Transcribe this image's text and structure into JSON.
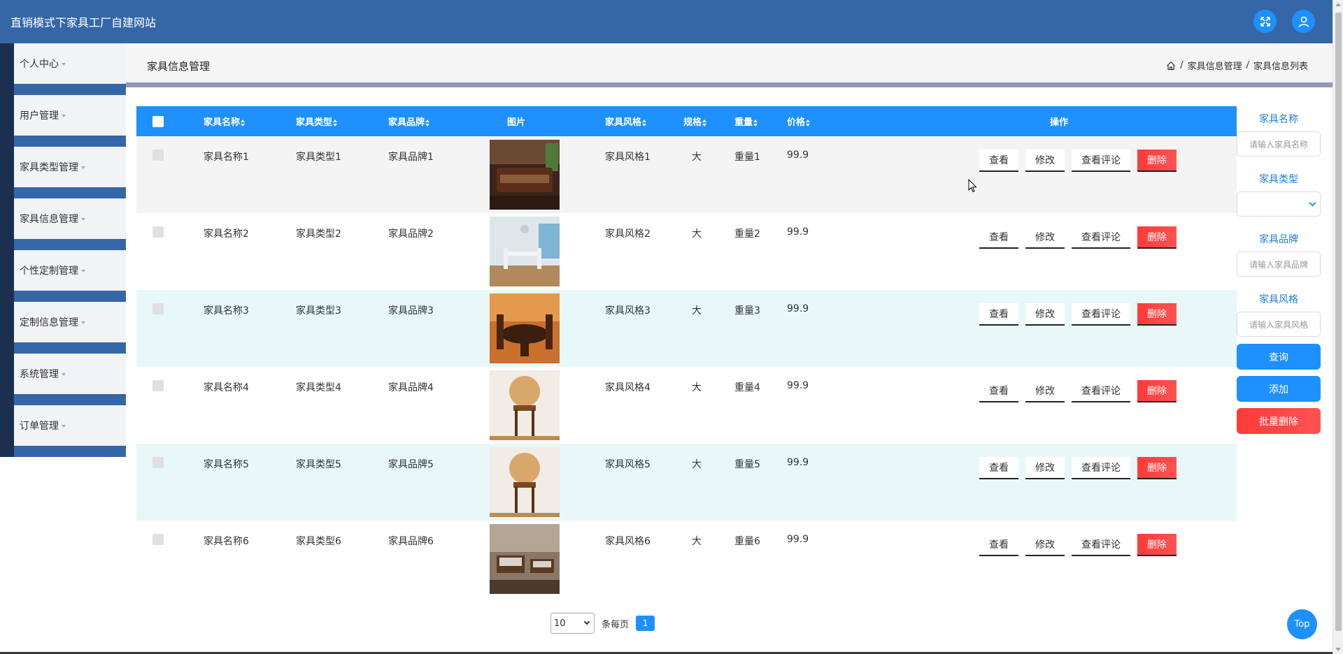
{
  "header": {
    "title": "直销模式下家具工厂自建网站"
  },
  "sidebar": {
    "items": [
      {
        "label": "个人中心"
      },
      {
        "label": "用户管理"
      },
      {
        "label": "家具类型管理"
      },
      {
        "label": "家具信息管理"
      },
      {
        "label": "个性定制管理"
      },
      {
        "label": "定制信息管理"
      },
      {
        "label": "系统管理"
      },
      {
        "label": "订单管理"
      }
    ]
  },
  "page": {
    "title": "家具信息管理",
    "breadcrumb": [
      "家具信息管理",
      "家具信息列表"
    ]
  },
  "table": {
    "headers": {
      "name": "家具名称",
      "type": "家具类型",
      "brand": "家具品牌",
      "image": "图片",
      "style": "家具风格",
      "spec": "规格",
      "weight": "重量",
      "price": "价格",
      "ops": "操作"
    },
    "actions": {
      "view": "查看",
      "edit": "修改",
      "comments": "查看评论",
      "delete": "删除"
    },
    "rows": [
      {
        "name": "家具名称1",
        "type": "家具类型1",
        "brand": "家具品牌1",
        "style": "家具风格1",
        "spec": "大",
        "weight": "重量1",
        "price": "99.9",
        "image_icon": "living-room-sofa-photo"
      },
      {
        "name": "家具名称2",
        "type": "家具类型2",
        "brand": "家具品牌2",
        "style": "家具风格2",
        "spec": "大",
        "weight": "重量2",
        "price": "99.9",
        "image_icon": "dining-room-photo"
      },
      {
        "name": "家具名称3",
        "type": "家具类型3",
        "brand": "家具品牌3",
        "style": "家具风格3",
        "spec": "大",
        "weight": "重量3",
        "price": "99.9",
        "image_icon": "round-dining-table-photo"
      },
      {
        "name": "家具名称4",
        "type": "家具类型4",
        "brand": "家具品牌4",
        "style": "家具风格4",
        "spec": "大",
        "weight": "重量4",
        "price": "99.9",
        "image_icon": "wooden-chair-photo"
      },
      {
        "name": "家具名称5",
        "type": "家具类型5",
        "brand": "家具品牌5",
        "style": "家具风格5",
        "spec": "大",
        "weight": "重量5",
        "price": "99.9",
        "image_icon": "wooden-chair-photo"
      },
      {
        "name": "家具名称6",
        "type": "家具类型6",
        "brand": "家具品牌6",
        "style": "家具风格6",
        "spec": "大",
        "weight": "重量6",
        "price": "99.9",
        "image_icon": "living-room-set-photo"
      }
    ]
  },
  "search": {
    "name_label": "家具名称",
    "name_placeholder": "请输入家具名称",
    "type_label": "家具类型",
    "type_value": "",
    "brand_label": "家具品牌",
    "brand_placeholder": "请输入家具品牌",
    "style_label": "家具风格",
    "style_placeholder": "请输入家具风格",
    "query_button": "查询",
    "add_button": "添加",
    "batch_delete_button": "批量删除"
  },
  "pagination": {
    "page_size": "10",
    "per_page_label": "条每页",
    "current_page": "1"
  },
  "top_button": "Top",
  "colors": {
    "header": "#3566a8",
    "primary": "#1e90ff",
    "danger": "#ff3a3a",
    "accent_bar": "#9196ba"
  }
}
